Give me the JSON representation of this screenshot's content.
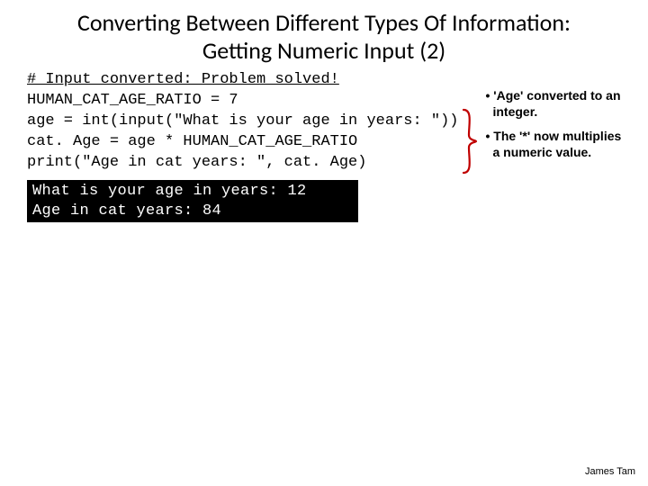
{
  "title_line1": "Converting Between Different Types Of Information:",
  "title_line2": "Getting Numeric Input  (2)",
  "code": {
    "line1": "# Input converted: Problem solved!",
    "line2": "HUMAN_CAT_AGE_RATIO = 7",
    "line3": "age = int(input(\"What is your age in years: \"))",
    "line4": "cat. Age = age * HUMAN_CAT_AGE_RATIO",
    "line5": "print(\"Age in cat years: \", cat. Age)"
  },
  "notes": {
    "n1": "'Age' converted to an integer.",
    "n2": "The '*' now multiplies a numeric value."
  },
  "bullet": "• ",
  "terminal": {
    "line1": "What is your age in years: 12",
    "line2": "Age in cat years:  84"
  },
  "footer": "James Tam"
}
